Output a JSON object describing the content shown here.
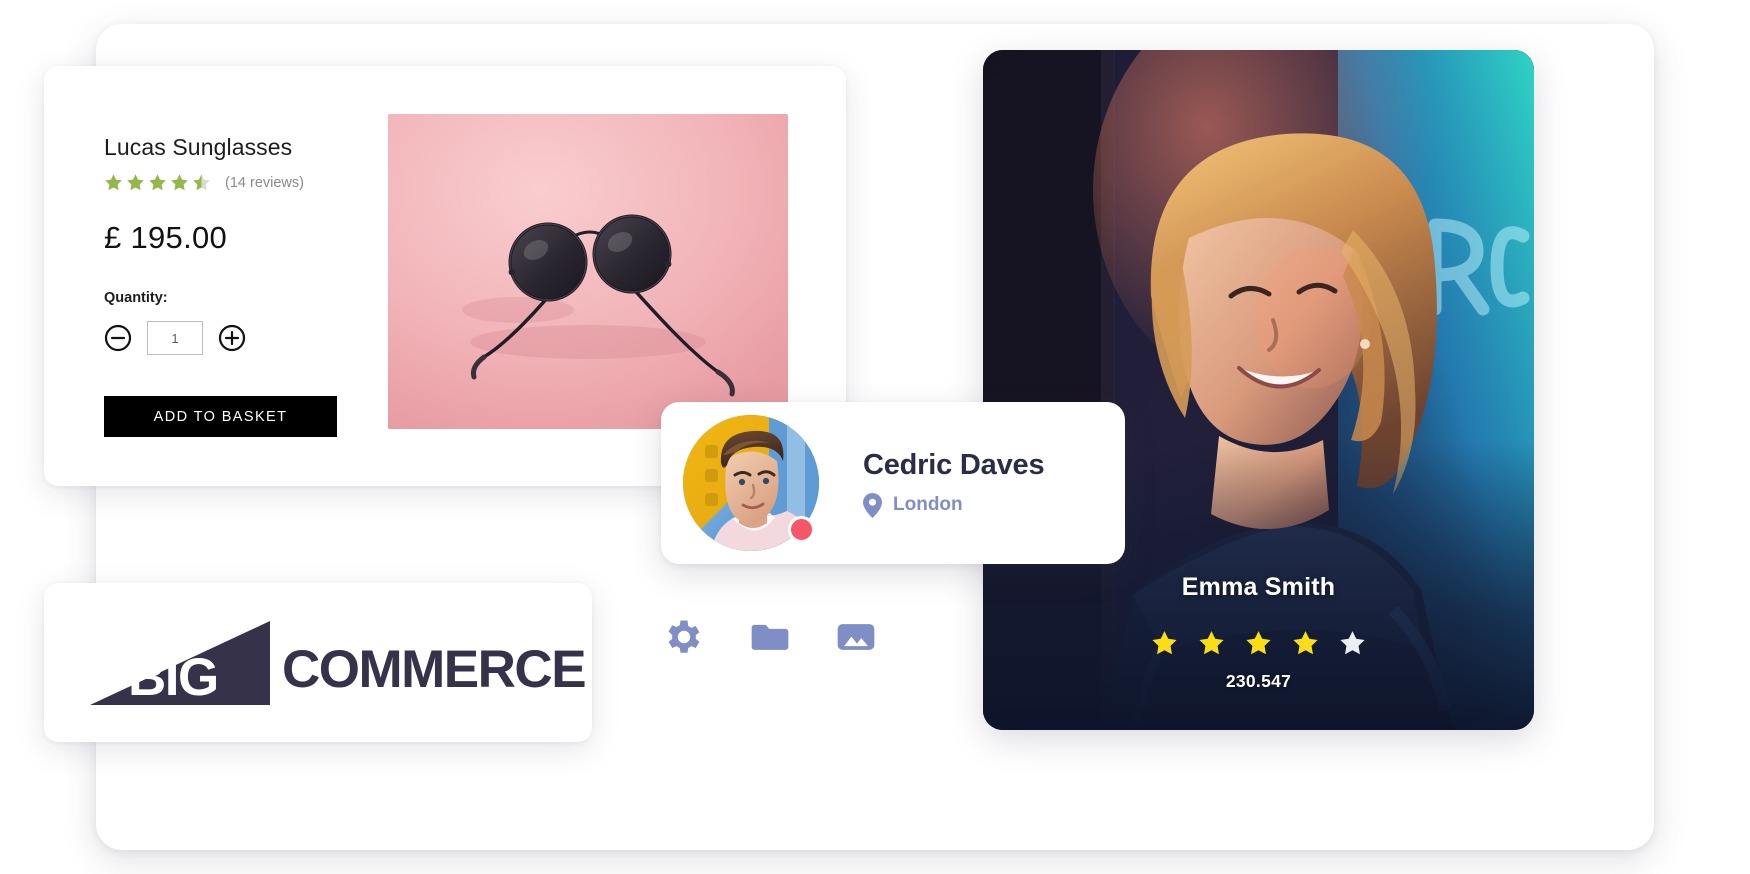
{
  "product": {
    "title": "Lucas Sunglasses",
    "rating": 4.5,
    "rating_max": 5,
    "reviews_text": "(14 reviews)",
    "price": "£ 195.00",
    "quantity_label": "Quantity:",
    "quantity_value": "1",
    "quantity_placeholder": "1",
    "decrease_label": "minus-circle-icon",
    "increase_label": "plus-circle-icon",
    "add_to_basket_label": "ADD TO BASKET",
    "photo_alt": "sunglasses-product-photo",
    "star_color": "#93b84a",
    "star_empty_color": "#d8dbd4"
  },
  "logo": {
    "mark_text": "BIG",
    "word_text": "COMMERCE",
    "color": "#35324a"
  },
  "icon_row": {
    "color": "#7f8fc6",
    "items": [
      {
        "name": "gear-icon",
        "label": "Settings"
      },
      {
        "name": "folder-icon",
        "label": "Files"
      },
      {
        "name": "image-icon",
        "label": "Images"
      }
    ]
  },
  "contact_card": {
    "name": "Cedric Daves",
    "location": "London",
    "location_icon": "map-pin-icon",
    "avatar_name": "avatar",
    "status": "online",
    "status_color": "#f7556a",
    "name_color": "#2b2d48",
    "location_color": "#7f8fc6"
  },
  "photo_card": {
    "name": "Emma Smith",
    "rating": 4,
    "rating_max": 5,
    "count": "230.547",
    "star_color": "#fbdd16",
    "star_empty_color": "#eceef2",
    "photo_alt": "emma-smith-neon-portrait"
  }
}
